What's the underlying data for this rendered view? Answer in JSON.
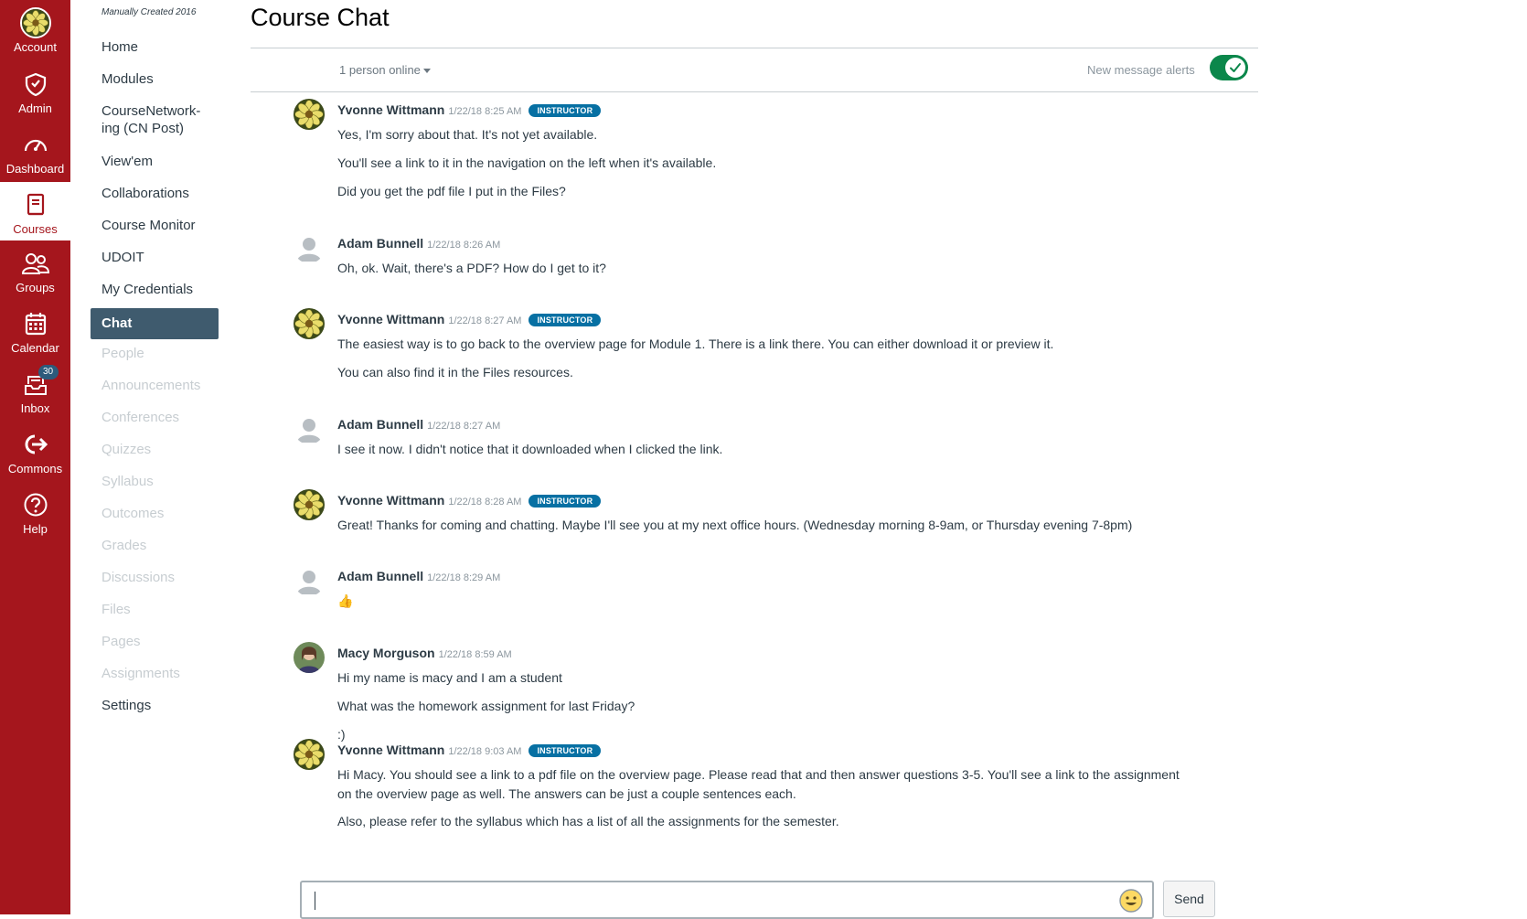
{
  "global_nav": [
    {
      "label": "Account",
      "icon": "account-avatar-icon"
    },
    {
      "label": "Admin",
      "icon": "admin-shield-icon"
    },
    {
      "label": "Dashboard",
      "icon": "dashboard-gauge-icon"
    },
    {
      "label": "Courses",
      "icon": "courses-book-icon",
      "active": true
    },
    {
      "label": "Groups",
      "icon": "groups-people-icon"
    },
    {
      "label": "Calendar",
      "icon": "calendar-icon"
    },
    {
      "label": "Inbox",
      "icon": "inbox-icon",
      "badge": "30"
    },
    {
      "label": "Commons",
      "icon": "commons-arrow-icon"
    },
    {
      "label": "Help",
      "icon": "help-question-icon"
    }
  ],
  "course_nav": {
    "caption": "Manually Created 2016",
    "items": [
      {
        "label": "Home",
        "state": "enabled"
      },
      {
        "label": "Modules",
        "state": "enabled"
      },
      {
        "label": "CourseNetwork-",
        "label2": "ing (CN Post)",
        "state": "enabled"
      },
      {
        "label": "View'em",
        "state": "enabled"
      },
      {
        "label": "Collaborations",
        "state": "enabled"
      },
      {
        "label": "Course Monitor",
        "state": "enabled"
      },
      {
        "label": "UDOIT",
        "state": "enabled"
      },
      {
        "label": "My Credentials",
        "state": "enabled"
      },
      {
        "label": "Chat",
        "state": "active"
      },
      {
        "label": "People",
        "state": "disabled"
      },
      {
        "label": "Announcements",
        "state": "disabled"
      },
      {
        "label": "Conferences",
        "state": "disabled"
      },
      {
        "label": "Quizzes",
        "state": "disabled"
      },
      {
        "label": "Syllabus",
        "state": "disabled"
      },
      {
        "label": "Outcomes",
        "state": "disabled"
      },
      {
        "label": "Grades",
        "state": "disabled"
      },
      {
        "label": "Discussions",
        "state": "disabled"
      },
      {
        "label": "Files",
        "state": "disabled"
      },
      {
        "label": "Pages",
        "state": "disabled"
      },
      {
        "label": "Assignments",
        "state": "disabled"
      },
      {
        "label": "Settings",
        "state": "enabled"
      }
    ]
  },
  "chat": {
    "title": "Course Chat",
    "online": "1 person online",
    "alerts_label": "New message alerts",
    "alerts_enabled": true,
    "messages": [
      {
        "author": "Yvonne Wittmann",
        "time": "1/22/18 8:25 AM",
        "role": "INSTRUCTOR",
        "avatar": "flower",
        "lines": [
          "Yes, I'm sorry about that. It's not yet available.",
          "You'll see a link to it in the navigation on the left when it's available.",
          "Did you get the pdf file I put in the Files?"
        ]
      },
      {
        "author": "Adam Bunnell",
        "time": "1/22/18 8:26 AM",
        "role": "",
        "avatar": "default",
        "lines": [
          "Oh, ok. Wait, there's a PDF? How do I get to it?"
        ]
      },
      {
        "author": "Yvonne Wittmann",
        "time": "1/22/18 8:27 AM",
        "role": "INSTRUCTOR",
        "avatar": "flower",
        "lines": [
          "The easiest way is to go back to the overview page for Module 1. There is a link there. You can either download it or preview it.",
          "You can also find it in the Files resources."
        ]
      },
      {
        "author": "Adam Bunnell",
        "time": "1/22/18 8:27 AM",
        "role": "",
        "avatar": "default",
        "lines": [
          "I see it now. I didn't notice that it downloaded when I clicked the link."
        ]
      },
      {
        "author": "Yvonne Wittmann",
        "time": "1/22/18 8:28 AM",
        "role": "INSTRUCTOR",
        "avatar": "flower",
        "lines": [
          "Great! Thanks for coming and chatting. Maybe I'll see you at my next office hours. (Wednesday morning 8-9am, or Thursday evening 7-8pm)"
        ]
      },
      {
        "author": "Adam Bunnell",
        "time": "1/22/18 8:29 AM",
        "role": "",
        "avatar": "default",
        "lines": [
          "👍"
        ]
      },
      {
        "author": "Macy Morguson",
        "time": "1/22/18 8:59 AM",
        "role": "",
        "avatar": "photo",
        "lines": [
          "Hi my name is macy and I am a student",
          "What was the homework assignment for last Friday?",
          ":)"
        ]
      },
      {
        "author": "Yvonne Wittmann",
        "time": "1/22/18 9:03 AM",
        "role": "INSTRUCTOR",
        "avatar": "flower",
        "lines": [
          "Hi Macy. You should see a link to a pdf file on the overview page. Please read that and then answer questions 3-5. You'll see a link to the assignment",
          "on the overview page as well. The answers can be just a couple sentences each.",
          "Also, please refer to the syllabus which has a list of all the assignments for the semester."
        ]
      }
    ],
    "composer": {
      "value": "",
      "send_label": "Send",
      "emoji_icon": "smiley-emoji-icon"
    }
  },
  "colors": {
    "brand": "#a5161d",
    "active_nav": "#3f5b6e",
    "instructor_badge": "#0770a3",
    "toggle_on": "#0b874b"
  }
}
